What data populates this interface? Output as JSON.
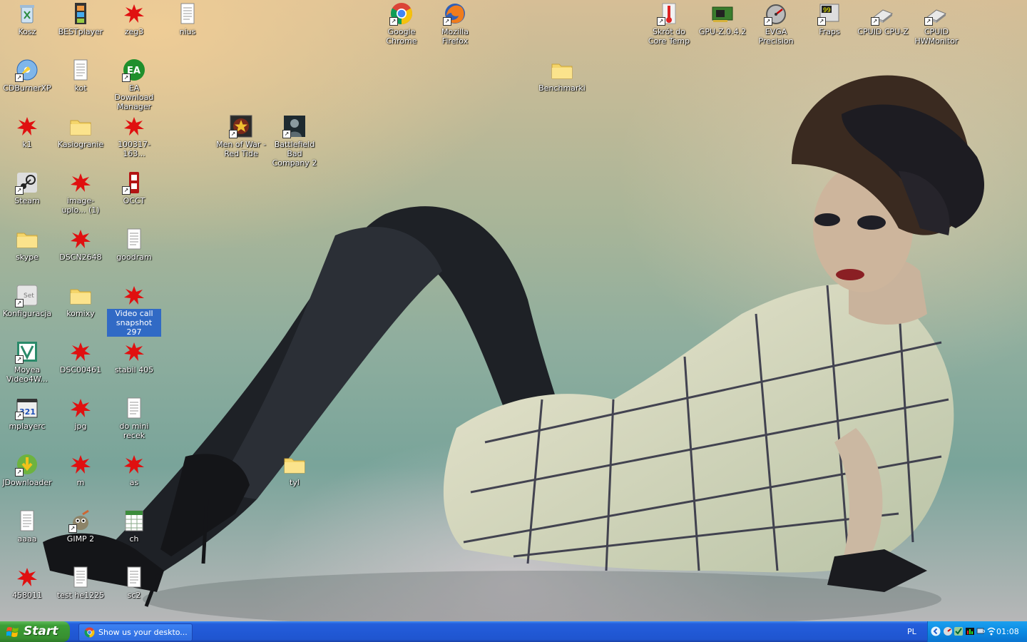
{
  "desktop": {
    "icons": [
      {
        "label": "Kosz",
        "icon": "recycle-bin-icon",
        "shortcut": false
      },
      {
        "label": "BESTplayer",
        "icon": "film-strip-icon",
        "shortcut": false
      },
      {
        "label": "zeg3",
        "icon": "splat-image-icon",
        "shortcut": false
      },
      {
        "label": "nius",
        "icon": "text-document-icon",
        "shortcut": false
      },
      {
        "label": "Google Chrome",
        "icon": "chrome-icon",
        "shortcut": true
      },
      {
        "label": "Mozilla Firefox",
        "icon": "firefox-icon",
        "shortcut": true
      },
      {
        "label": "Skrót do Core Temp",
        "icon": "thermometer-icon",
        "shortcut": true
      },
      {
        "label": "GPU-Z.0.4.2",
        "icon": "graphics-card-icon",
        "shortcut": false
      },
      {
        "label": "EVGA Precision",
        "icon": "gauge-icon",
        "shortcut": true
      },
      {
        "label": "Fraps",
        "icon": "fraps-icon",
        "shortcut": true
      },
      {
        "label": "CPUID CPU-Z",
        "icon": "cpu-chip-icon",
        "shortcut": true
      },
      {
        "label": "CPUID HWMonitor",
        "icon": "cpu-chip-icon",
        "shortcut": true
      },
      {
        "label": "CDBurnerXP",
        "icon": "disc-icon",
        "shortcut": true
      },
      {
        "label": "kot",
        "icon": "text-document-icon",
        "shortcut": false
      },
      {
        "label": "EA Download Manager",
        "icon": "ea-icon",
        "shortcut": true
      },
      {
        "label": "Benchmarki",
        "icon": "folder-icon",
        "shortcut": false
      },
      {
        "label": "k1",
        "icon": "splat-image-icon",
        "shortcut": false
      },
      {
        "label": "Kasiogranie",
        "icon": "folder-icon",
        "shortcut": false
      },
      {
        "label": "100317-163...",
        "icon": "splat-image-icon",
        "shortcut": false
      },
      {
        "label": "Men of War - Red Tide",
        "icon": "game-star-icon",
        "shortcut": true
      },
      {
        "label": "Battlefield Bad Company 2",
        "icon": "soldier-icon",
        "shortcut": true
      },
      {
        "label": "Steam",
        "icon": "steam-icon",
        "shortcut": true
      },
      {
        "label": "image-uplo... (1)",
        "icon": "splat-image-icon",
        "shortcut": false
      },
      {
        "label": "OCCT",
        "icon": "occt-icon",
        "shortcut": true
      },
      {
        "label": "skype",
        "icon": "folder-icon",
        "shortcut": false
      },
      {
        "label": "DSCN2648",
        "icon": "splat-image-icon",
        "shortcut": false
      },
      {
        "label": "goodram",
        "icon": "text-document-icon",
        "shortcut": false
      },
      {
        "label": "Konfiguracja",
        "icon": "settings-app-icon",
        "shortcut": true
      },
      {
        "label": "komixy",
        "icon": "folder-icon",
        "shortcut": false
      },
      {
        "label": "Video call snapshot 297",
        "icon": "splat-image-icon",
        "shortcut": false,
        "selected": true
      },
      {
        "label": "Moyea Video4W...",
        "icon": "moyea-icon",
        "shortcut": true
      },
      {
        "label": "DSC00461",
        "icon": "splat-image-icon",
        "shortcut": false
      },
      {
        "label": "stabil 405",
        "icon": "splat-image-icon",
        "shortcut": false
      },
      {
        "label": "mplayerc",
        "icon": "media-player-icon",
        "shortcut": true
      },
      {
        "label": "jpg",
        "icon": "splat-image-icon",
        "shortcut": false
      },
      {
        "label": "do mini recek",
        "icon": "text-document-icon",
        "shortcut": false
      },
      {
        "label": "JDownloader",
        "icon": "jdownloader-icon",
        "shortcut": true
      },
      {
        "label": "m",
        "icon": "splat-image-icon",
        "shortcut": false
      },
      {
        "label": "as",
        "icon": "splat-image-icon",
        "shortcut": false
      },
      {
        "label": "tyl",
        "icon": "folder-icon",
        "shortcut": false
      },
      {
        "label": "aaaa",
        "icon": "text-document-icon",
        "shortcut": false
      },
      {
        "label": "GIMP 2",
        "icon": "gimp-icon",
        "shortcut": true
      },
      {
        "label": "ch",
        "icon": "spreadsheet-icon",
        "shortcut": false
      },
      {
        "label": "458011",
        "icon": "splat-image-icon",
        "shortcut": false
      },
      {
        "label": "test he1225",
        "icon": "text-document-icon",
        "shortcut": false
      },
      {
        "label": "sc2",
        "icon": "text-document-icon",
        "shortcut": false
      }
    ]
  },
  "taskbar": {
    "start_label": "Start",
    "task_label": "Show us your deskto...",
    "language": "PL",
    "clock": "01:08"
  },
  "colors": {
    "taskbar_blue": "#245edb",
    "start_green": "#3c9e36",
    "tray_blue": "#0c8be3",
    "selection": "#316ac5"
  }
}
